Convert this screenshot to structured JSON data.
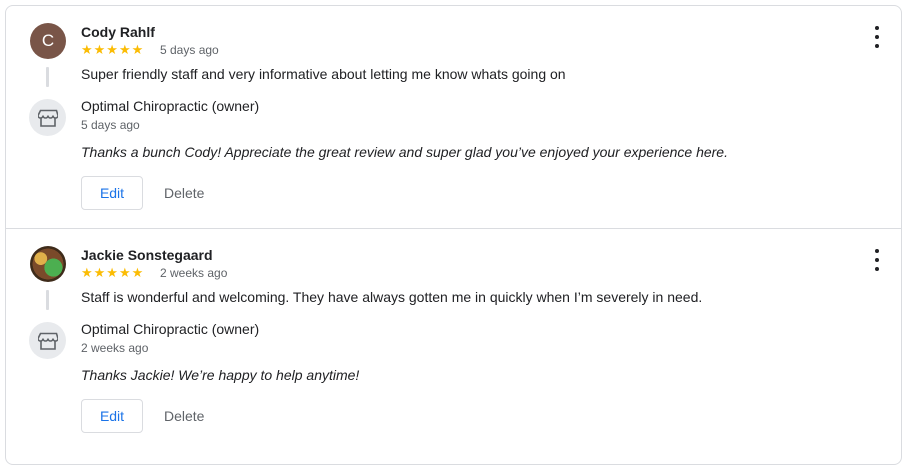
{
  "reviews": [
    {
      "avatar_letter": "C",
      "reviewer": "Cody Rahlf",
      "stars": "★★★★★",
      "rating": 5,
      "time": "5 days ago",
      "text": "Super friendly staff and very informative about letting me know whats going on",
      "owner_name": "Optimal Chiropractic (owner)",
      "owner_time": "5 days ago",
      "reply": "Thanks a bunch Cody! Appreciate the great review and super glad you’ve enjoyed your experience here.",
      "edit_label": "Edit",
      "delete_label": "Delete"
    },
    {
      "avatar_letter": "",
      "reviewer": "Jackie Sonstegaard",
      "stars": "★★★★★",
      "rating": 5,
      "time": "2 weeks ago",
      "text": "Staff is wonderful and welcoming. They have always gotten me in quickly when I’m severely in need.",
      "owner_name": "Optimal Chiropractic (owner)",
      "owner_time": "2 weeks ago",
      "reply": "Thanks Jackie! We’re happy to help anytime!",
      "edit_label": "Edit",
      "delete_label": "Delete"
    }
  ],
  "colors": {
    "star": "#fbbc04",
    "edit": "#1a73e8",
    "avatar": "#795548"
  },
  "icons": {
    "owner": "storefront-icon",
    "menu": "more-vert-icon"
  }
}
